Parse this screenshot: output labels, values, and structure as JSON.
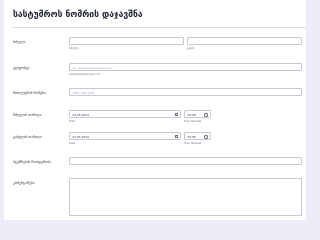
{
  "form": {
    "title": "სასტუმროს ნომრის დაჯავშნა",
    "name": {
      "label": "სახელი",
      "first_sub": "სახელი",
      "last_sub": "გვარი",
      "first_value": "",
      "last_value": ""
    },
    "email": {
      "label": "ელფოსტა",
      "placeholder": "ex: myname@example.com",
      "sub": "example@example.com"
    },
    "phone": {
      "label": "მობილურის ნომერი",
      "placeholder": "(000) 000-0000"
    },
    "arrival": {
      "label": "მისვლის თარიღი",
      "date_value": "03-05-2024",
      "date_sub": "Date",
      "time_value": "03:58",
      "time_sub": "Hour Minutes"
    },
    "departure": {
      "label": "გასვლის თარიღი",
      "date_value": "03-05-2024",
      "date_sub": "Date",
      "time_value": "03:58",
      "time_sub": "Hour Minutes"
    },
    "guests": {
      "label": "სტუმრების რაოდენობა",
      "value": ""
    },
    "comments": {
      "label": "კომენტარები",
      "value": ""
    }
  }
}
